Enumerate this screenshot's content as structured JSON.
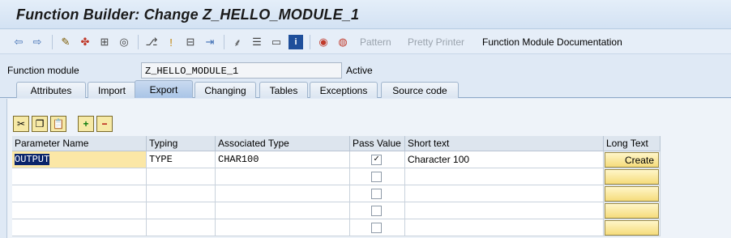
{
  "window": {
    "title": "Function Builder: Change Z_HELLO_MODULE_1"
  },
  "toolbar": {
    "icons": [
      "back-arrow-icon",
      "forward-arrow-icon",
      "display-change-icon",
      "active-inactive-icon",
      "object-list-icon",
      "where-used-icon",
      "navigate-icon",
      "display-object-list-icon",
      "enhance-icon",
      "hierarchy-icon",
      "stack-icon",
      "screen-icon",
      "info-icon",
      "other-object-icon",
      "delete-icon"
    ],
    "pattern_label": "Pattern",
    "pretty_printer_label": "Pretty Printer",
    "documentation_label": "Function Module Documentation"
  },
  "function_module": {
    "label": "Function module",
    "value": "Z_HELLO_MODULE_1",
    "status": "Active"
  },
  "tabs": [
    {
      "label": "Attributes",
      "active": false
    },
    {
      "label": "Import",
      "active": false
    },
    {
      "label": "Export",
      "active": true
    },
    {
      "label": "Changing",
      "active": false
    },
    {
      "label": "Tables",
      "active": false
    },
    {
      "label": "Exceptions",
      "active": false
    },
    {
      "label": "Source code",
      "active": false
    }
  ],
  "table": {
    "columns": [
      "Parameter Name",
      "Typing",
      "Associated Type",
      "Pass Value",
      "Short text",
      "Long Text"
    ],
    "rows": [
      {
        "name": "OUTPUT",
        "typing": "TYPE",
        "assoc": "CHAR100",
        "pass_value": true,
        "short_text": "Character 100",
        "long_text": "Create"
      },
      {
        "name": "",
        "typing": "",
        "assoc": "",
        "pass_value": false,
        "short_text": "",
        "long_text": ""
      },
      {
        "name": "",
        "typing": "",
        "assoc": "",
        "pass_value": false,
        "short_text": "",
        "long_text": ""
      },
      {
        "name": "",
        "typing": "",
        "assoc": "",
        "pass_value": false,
        "short_text": "",
        "long_text": ""
      },
      {
        "name": "",
        "typing": "",
        "assoc": "",
        "pass_value": false,
        "short_text": "",
        "long_text": ""
      }
    ]
  },
  "table_toolbar": [
    "cut-icon",
    "copy-icon",
    "paste-icon",
    "insert-row-icon",
    "delete-row-icon"
  ]
}
